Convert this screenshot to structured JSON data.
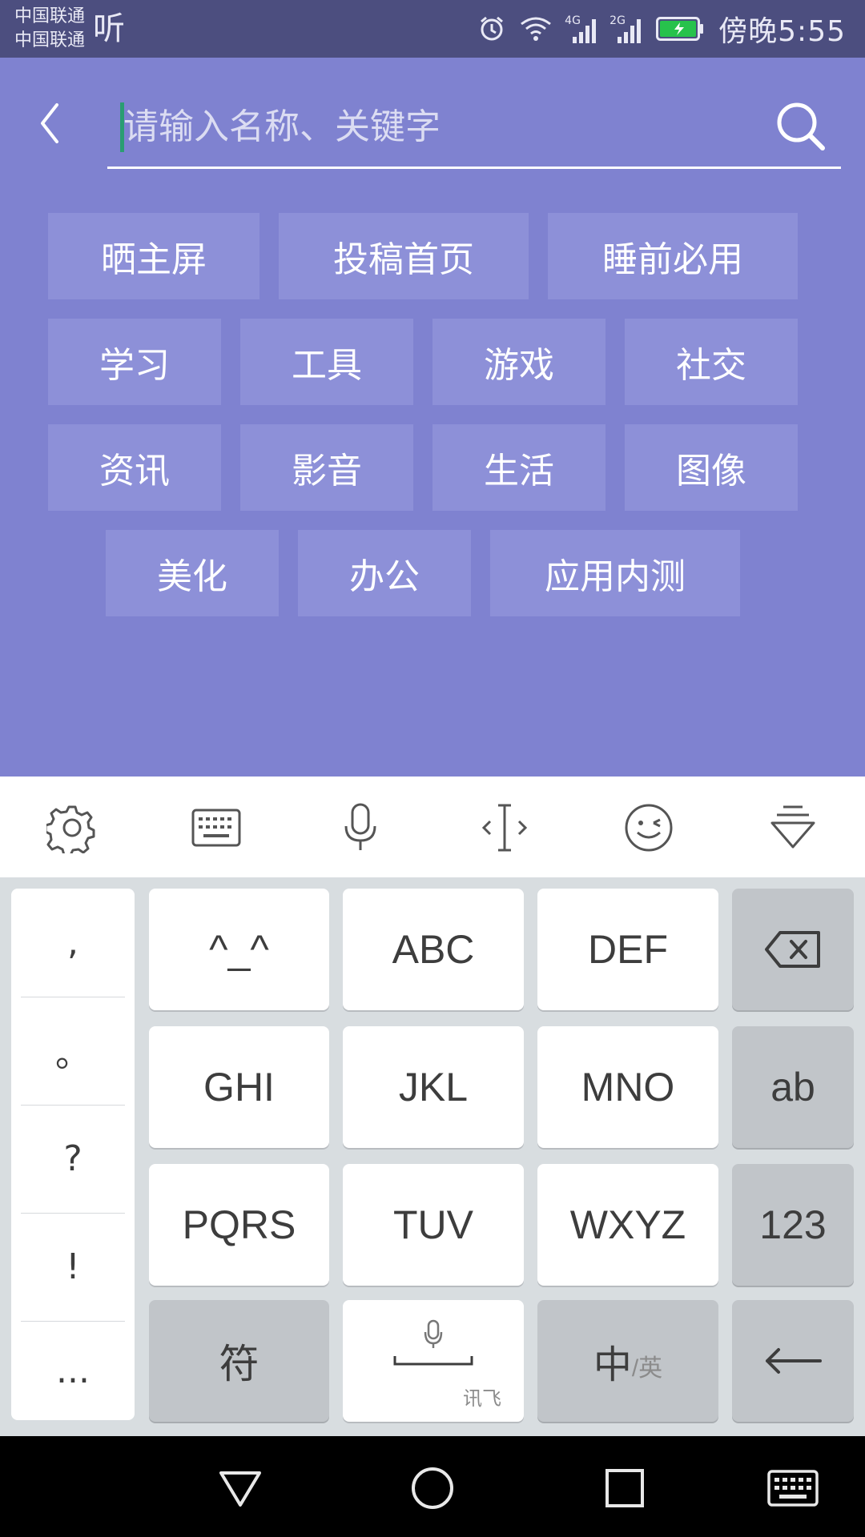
{
  "status_bar": {
    "carrier_1": "中国联通",
    "carrier_2": "中国联通",
    "extra_icon_text": "听",
    "network_1": "4G",
    "network_2": "2G",
    "time": "傍晚5:55",
    "battery_color": "#27c24c"
  },
  "search": {
    "placeholder": "请输入名称、关键字",
    "value": ""
  },
  "tags": [
    "晒主屏",
    "投稿首页",
    "睡前必用",
    "学习",
    "工具",
    "游戏",
    "社交",
    "资讯",
    "影音",
    "生活",
    "图像",
    "美化",
    "办公",
    "应用内测"
  ],
  "keyboard": {
    "punctuation": [
      ",",
      "。",
      "?",
      "!",
      "..."
    ],
    "keys": {
      "emoticon": "^_^",
      "abc": "ABC",
      "def": "DEF",
      "ghi": "GHI",
      "jkl": "JKL",
      "mno": "MNO",
      "ab": "ab",
      "pqrs": "PQRS",
      "tuv": "TUV",
      "wxyz": "WXYZ",
      "num": "123",
      "symbol": "符",
      "space_brand": "讯飞",
      "lang_main": "中",
      "lang_alt": "/英"
    }
  },
  "colors": {
    "accent": "#7f82d0",
    "status_bar": "#4c4e7f",
    "tag_bg": "#8d90d8"
  }
}
